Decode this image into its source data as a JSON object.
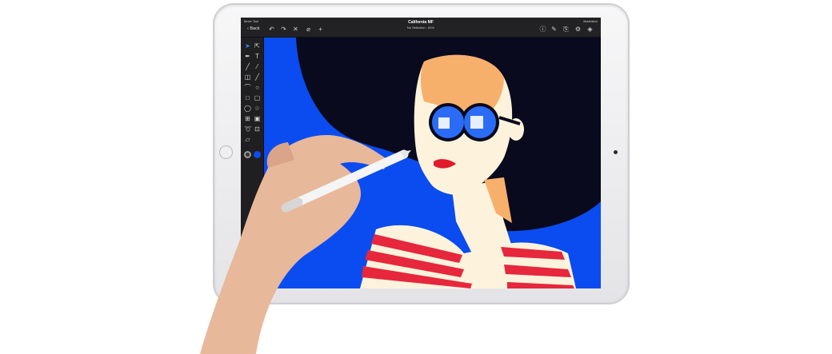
{
  "device": {
    "name": "iPad Pro"
  },
  "app": {
    "top_left_label": "Move Tool",
    "back_label": "Back",
    "document_title": "California MF",
    "selection_status": "No Selection - 81%",
    "app_label": "illustration"
  },
  "toolbar": {
    "tools": [
      "selection-tool",
      "direct-selection-tool",
      "pen-tool",
      "type-tool",
      "brush-tool",
      "eyedropper-tool",
      "eraser-tool",
      "line-tool",
      "arc-tool",
      "ellipse-tool",
      "rectangle-tool",
      "rounded-rect-tool",
      "circle-tool",
      "star-tool",
      "grid-tool",
      "image-tool",
      "lasso-tool",
      "frame-tool",
      "transform-tool"
    ],
    "active_tool": "selection-tool",
    "stroke_color": "#9a9a9a",
    "fill_color": "#0b4cf0"
  },
  "colors": {
    "canvas_blue": "#0b4cf0",
    "hat_black": "#0a0a1e",
    "skin": "#f7b06b",
    "cream": "#fdf3dd",
    "stripe_red": "#e6273c",
    "lips": "#e11b2b"
  }
}
